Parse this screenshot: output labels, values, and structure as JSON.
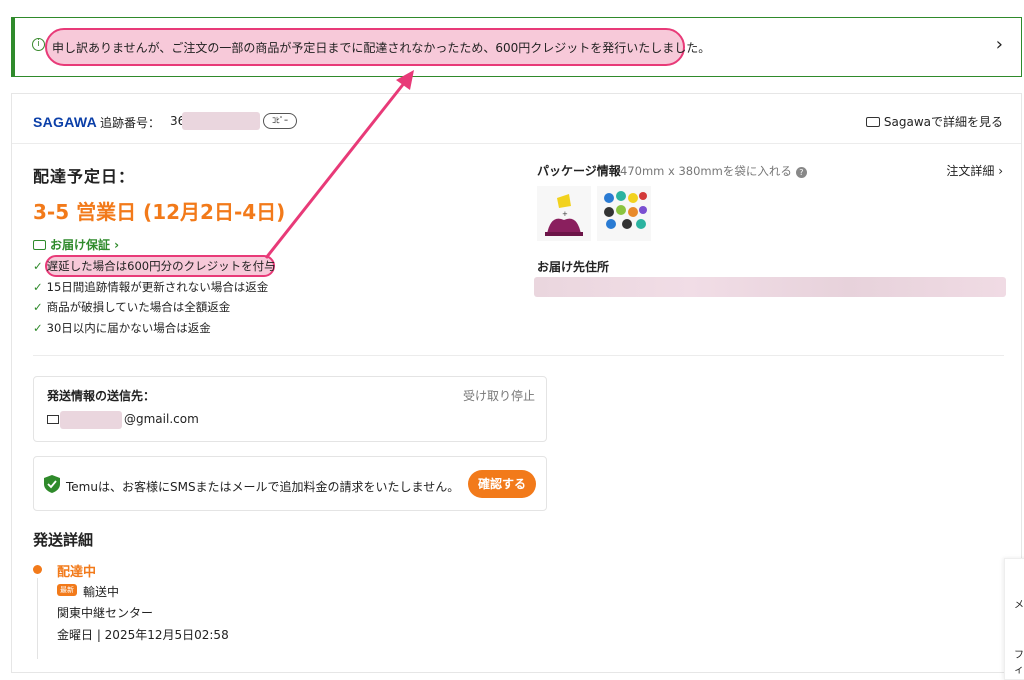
{
  "banner": {
    "message": "申し訳ありませんが、ご注文の一部の商品が予定日までに配達されなかったため、600円クレジットを発行いたしました。",
    "info_icon": "info-icon",
    "chevron": "›"
  },
  "tracking": {
    "carrier": "SAGAWA",
    "label": "追跡番号：",
    "number_prefix": "36",
    "copy_label": "ｺﾋﾟｰ",
    "view_label": "Sagawaで詳細を見る"
  },
  "delivery": {
    "label": "配達予定日：",
    "date": "3-5 営業日 (12月2日-4日)",
    "guarantee_title": "お届け保証 ›",
    "guarantees": [
      "遅延した場合は600円分のクレジットを付与",
      "15日間追跡情報が更新されない場合は返金",
      "商品が破損していた場合は全額返金",
      "30日以内に届かない場合は返金"
    ]
  },
  "package": {
    "label": "パッケージ情報",
    "description": "470mm x 380mmを袋に入れる",
    "help_icon": "?",
    "order_details": "注文詳細 ›",
    "address_label": "お届け先住所"
  },
  "notification": {
    "label": "発送情報の送信先：",
    "stop_label": "受け取り停止",
    "email_suffix": "@gmail.com"
  },
  "sms_notice": {
    "text": "Temuは、お客様にSMSまたはメールで追加料金の請求をいたしません。",
    "button": "確認する"
  },
  "shipping": {
    "title": "発送詳細",
    "status": "配達中",
    "badge": "最新",
    "event": "輸送中",
    "location": "関東中継センター",
    "datetime": "金曜日 | 2025年12月5日02:58"
  },
  "side": {
    "m": "メ",
    "f": "フィ"
  },
  "colors": {
    "accent": "#f27a1a",
    "green": "#2f8a2b",
    "highlight": "#e83a78",
    "carrier": "#0b3fa8"
  }
}
